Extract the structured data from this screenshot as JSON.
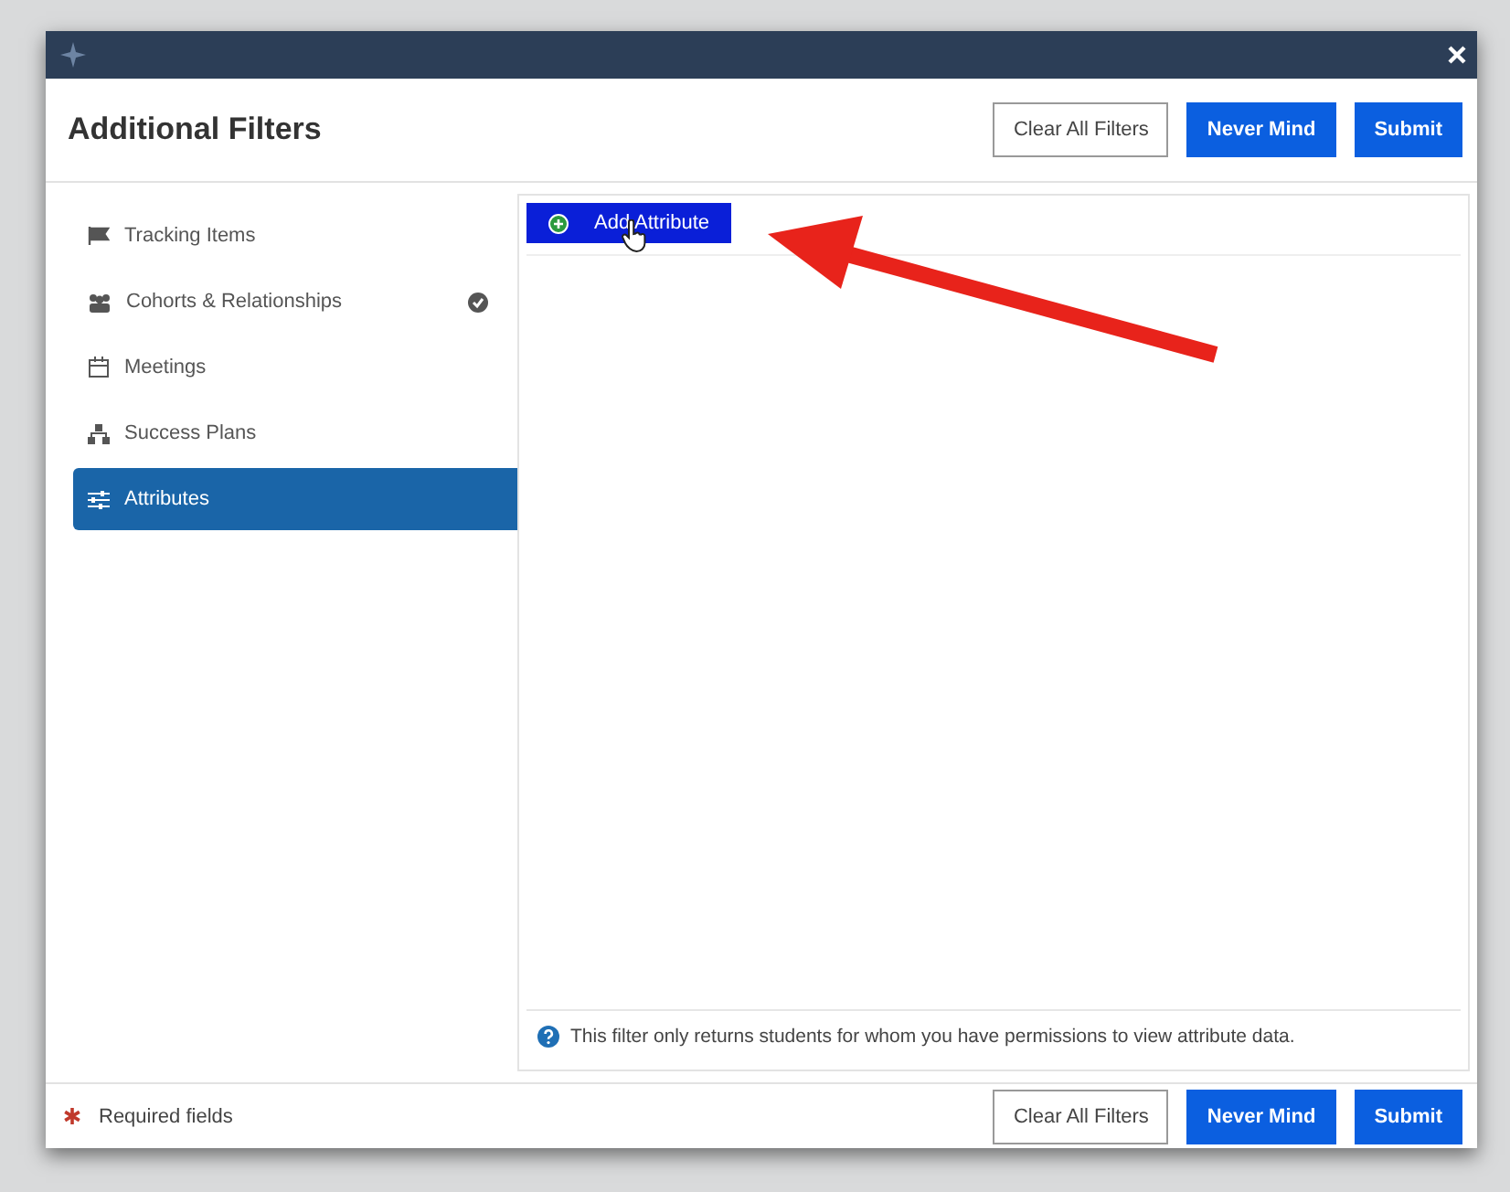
{
  "dialog": {
    "title": "Additional Filters",
    "header_buttons": [
      {
        "label": "Clear All Filters",
        "kind": "outline"
      },
      {
        "label": "Never Mind",
        "kind": "primary"
      },
      {
        "label": "Submit",
        "kind": "primary"
      }
    ]
  },
  "sidebar": {
    "items": [
      {
        "label": "Tracking Items",
        "kind": "flag",
        "selected": false,
        "checked": false
      },
      {
        "label": "Cohorts & Relationships",
        "kind": "users",
        "selected": false,
        "checked": true
      },
      {
        "label": "Meetings",
        "kind": "calendar",
        "selected": false,
        "checked": false
      },
      {
        "label": "Success Plans",
        "kind": "plan",
        "selected": false,
        "checked": false
      },
      {
        "label": "Attributes",
        "kind": "sliders",
        "selected": true,
        "checked": false
      }
    ]
  },
  "content": {
    "add_button": "Add Attribute",
    "note": "This filter only returns students for whom you have permissions to view attribute data."
  },
  "footer": {
    "required_label": "Required fields",
    "buttons": [
      {
        "label": "Clear All Filters",
        "kind": "outline"
      },
      {
        "label": "Never Mind",
        "kind": "primary"
      },
      {
        "label": "Submit",
        "kind": "primary"
      }
    ]
  }
}
